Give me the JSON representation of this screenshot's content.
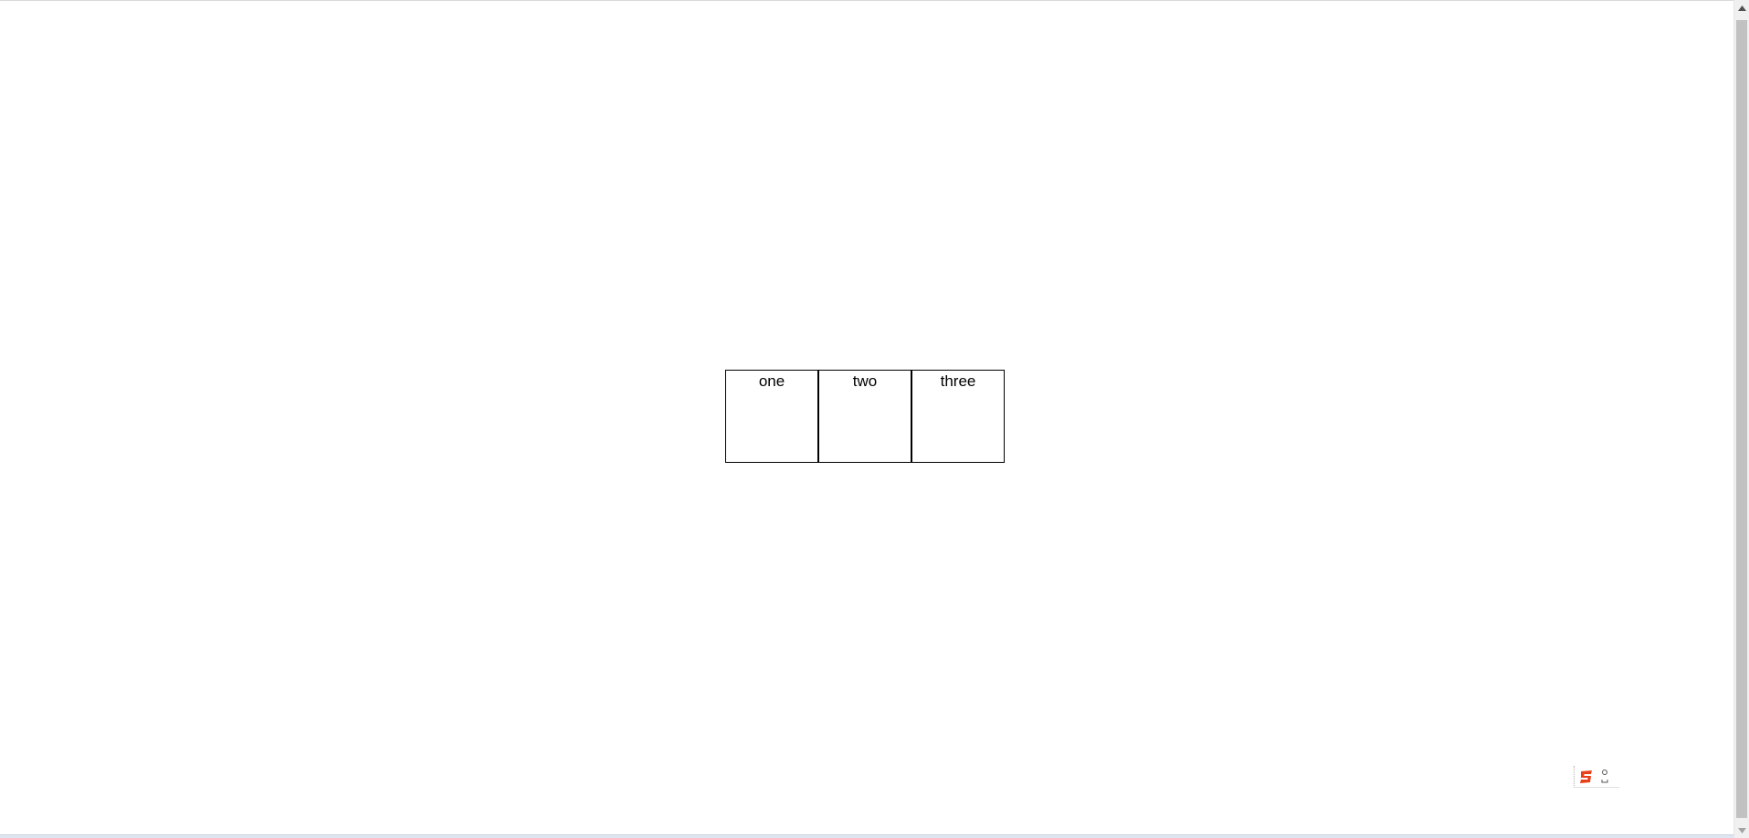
{
  "boxes": [
    {
      "label": "one"
    },
    {
      "label": "two"
    },
    {
      "label": "three"
    }
  ],
  "ime_toolbar": {
    "logo_icon": "sogou-s-icon",
    "mode_icon": "punctuation-mode-icon",
    "accent": "#e8411a"
  },
  "scrollbar": {
    "up_icon": "scroll-up-arrow-icon",
    "down_icon": "scroll-down-arrow-icon"
  }
}
